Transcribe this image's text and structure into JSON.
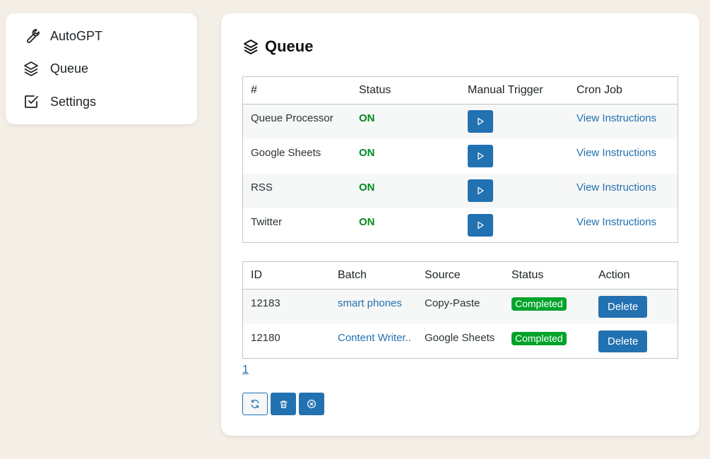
{
  "sidebar": {
    "items": [
      {
        "label": "AutoGPT",
        "icon": "wrench-icon"
      },
      {
        "label": "Queue",
        "icon": "layers-icon"
      },
      {
        "label": "Settings",
        "icon": "checkbox-icon"
      }
    ]
  },
  "page": {
    "title": "Queue",
    "icon": "layers-icon"
  },
  "processes": {
    "headers": [
      "#",
      "Status",
      "Manual Trigger",
      "Cron Job"
    ],
    "rows": [
      {
        "name": "Queue Processor",
        "status": "ON",
        "link": "View Instructions"
      },
      {
        "name": "Google Sheets",
        "status": "ON",
        "link": "View Instructions"
      },
      {
        "name": "RSS",
        "status": "ON",
        "link": "View Instructions"
      },
      {
        "name": "Twitter",
        "status": "ON",
        "link": "View Instructions"
      }
    ]
  },
  "queue": {
    "headers": [
      "ID",
      "Batch",
      "Source",
      "Status",
      "Action"
    ],
    "rows": [
      {
        "id": "12183",
        "batch": "smart phones",
        "source": "Copy-Paste",
        "status": "Completed",
        "action": "Delete"
      },
      {
        "id": "12180",
        "batch": "Content Writer..",
        "source": "Google Sheets",
        "status": "Completed",
        "action": "Delete"
      }
    ]
  },
  "pagination": {
    "current": "1"
  },
  "toolbar": {
    "icons": [
      "refresh-icon",
      "trash-icon",
      "cancel-circle-icon"
    ]
  },
  "colors": {
    "accent": "#2271b1",
    "on": "#008a20",
    "badge": "#00a32a",
    "background": "#f3efe6"
  }
}
